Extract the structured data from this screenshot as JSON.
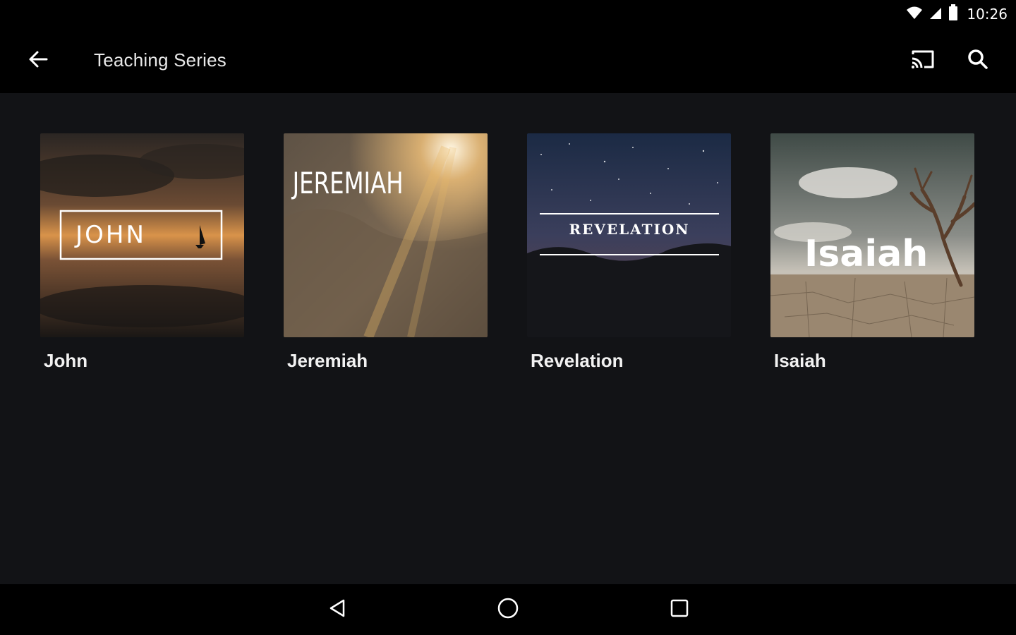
{
  "status_bar": {
    "time": "10:26",
    "icons": [
      "wifi-icon",
      "cell-signal-icon",
      "battery-icon"
    ]
  },
  "app_bar": {
    "title": "Teaching Series",
    "icons": [
      "back-arrow-icon",
      "cast-icon",
      "search-icon"
    ]
  },
  "series": [
    {
      "label": "John",
      "art_text": "JOHN"
    },
    {
      "label": "Jeremiah",
      "art_text": "JEREMIAH"
    },
    {
      "label": "Revelation",
      "art_text": "REVELATION"
    },
    {
      "label": "Isaiah",
      "art_text": "Isaiah"
    }
  ],
  "nav_bar": {
    "icons": [
      "back-triangle-icon",
      "home-circle-icon",
      "recents-square-icon"
    ]
  },
  "colors": {
    "background": "#121316",
    "bars": "#000000",
    "text": "#ffffff"
  }
}
